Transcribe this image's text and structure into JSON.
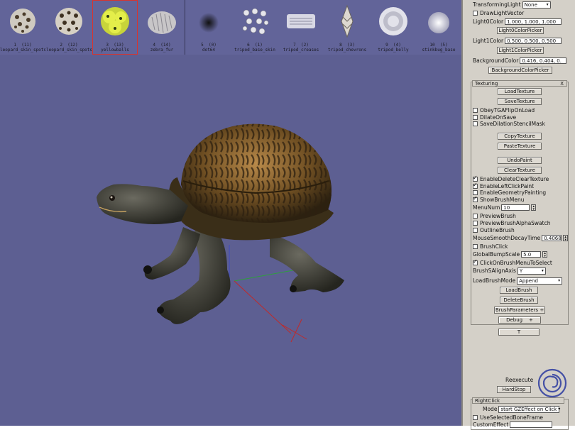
{
  "brushes": [
    {
      "num": "1",
      "count": "(11)",
      "name": "leopard_skin_spots"
    },
    {
      "num": "2",
      "count": "(12)",
      "name": "leopard_skin_spots"
    },
    {
      "num": "3",
      "count": "(13)",
      "name": "yellowballs",
      "selected": true
    },
    {
      "num": "4",
      "count": "(14)",
      "name": "zebra_fur"
    },
    {
      "num": "5",
      "count": "(0)",
      "name": "dot64"
    },
    {
      "num": "6",
      "count": "(1)",
      "name": "tripod_base_skin"
    },
    {
      "num": "7",
      "count": "(2)",
      "name": "tripod_creases"
    },
    {
      "num": "8",
      "count": "(3)",
      "name": "tripod_chevrons"
    },
    {
      "num": "9",
      "count": "(4)",
      "name": "tripod_belly"
    },
    {
      "num": "10",
      "count": "(5)",
      "name": "stinkbug_base"
    }
  ],
  "panel": {
    "transforming_light_label": "TransformingLight",
    "transforming_light_value": "None",
    "draw_light_vector": "DrawLightVector",
    "light0_label": "Light0Color",
    "light0_value": "1.000, 1.000, 1.000",
    "light0_picker": "Light0ColorPicker",
    "light1_label": "Light1Color",
    "light1_value": "0.500, 0.500, 0.500",
    "light1_picker": "Light1ColorPicker",
    "bg_label": "BackgroundColor",
    "bg_value": "0.416, 0.404, 0.",
    "bg_picker": "BackgroundColorPicker",
    "texturing_title": "Texturing",
    "texturing_close": "X",
    "load_texture": "LoadTexture",
    "save_texture": "SaveTexture",
    "obey_tga": "ObeyTGAFlipOnLoad",
    "dilate_on_save": "DilateOnSave",
    "save_dilation": "SaveDilationStencilMask",
    "copy_texture": "CopyTexture",
    "paste_texture": "PasteTexture",
    "undo_paint": "UndoPaint",
    "clear_texture": "ClearTexture",
    "enable_delete_clear": "EnableDeleteClearTexture",
    "enable_left_click": "EnableLeftClickPaint",
    "enable_geometry": "EnableGeometryPainting",
    "show_brush_menu": "ShowBrushMenu",
    "menu_num_label": "MenuNum",
    "menu_num_value": "10",
    "preview_brush": "PreviewBrush",
    "preview_alpha": "PreviewBrushAlphaSwatch",
    "outline_brush": "OutlineBrush",
    "mouse_smooth_label": "MouseSmoothDecayTime",
    "mouse_smooth_value": "0.4068",
    "brush_click": "BrushClick",
    "global_bump_label": "GlobalBumpScale",
    "global_bump_value": "5.0",
    "click_on_brush": "ClickOnBrushMenuToSelect",
    "align_axis_label": "BrushSAlignAxis",
    "align_axis_value": "Y",
    "load_mode_label": "LoadBrushMode",
    "load_mode_value": "Append",
    "load_brush": "LoadBrush",
    "delete_brush": "DeleteBrush",
    "brush_parameters": "BrushParameters",
    "debug": "Debug",
    "t_button": "T",
    "reexecute": "Reexecute",
    "hardstop": "HardStop",
    "rightclick_title": "RightClick",
    "mode_label": "Mode",
    "mode_value": "start GZEffect on Click",
    "use_selected_bone": "UseSelectedBoneFrame",
    "custom_effect": "CustomEffect"
  }
}
